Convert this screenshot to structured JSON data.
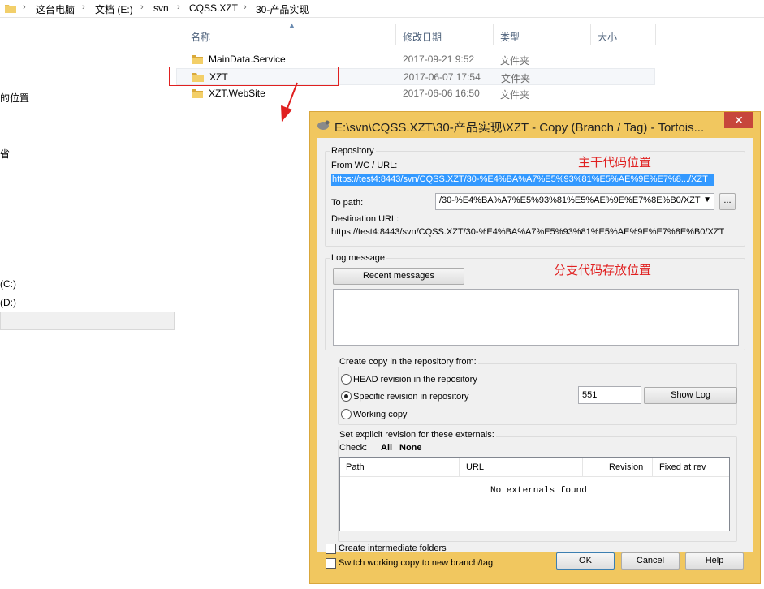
{
  "address_bar": {
    "crumbs": [
      "这台电脑",
      "文档 (E:)",
      "svn",
      "CQSS.XZT",
      "30-产品实现"
    ]
  },
  "nav_pane": {
    "items": [
      "的位置",
      "省",
      "(C:)",
      "(D:)"
    ]
  },
  "file_list": {
    "columns": {
      "name": "名称",
      "date": "修改日期",
      "type": "类型",
      "size": "大小"
    },
    "rows": [
      {
        "name": "MainData.Service",
        "date": "2017-09-21 9:52",
        "type": "文件夹"
      },
      {
        "name": "XZT",
        "date": "2017-06-07 17:54",
        "type": "文件夹"
      },
      {
        "name": "XZT.WebSite",
        "date": "2017-06-06 16:50",
        "type": "文件夹"
      }
    ]
  },
  "annotations": {
    "trunk_label": "主干代码位置",
    "branch_label": "分支代码存放位置",
    "color": "#e02020"
  },
  "dialog": {
    "title": "E:\\svn\\CQSS.XZT\\30-产品实现\\XZT - Copy (Branch / Tag) - Tortois...",
    "close_glyph": "✕",
    "repository": {
      "group_label": "Repository",
      "from_label": "From WC / URL:",
      "from_url": "https://test4:8443/svn/CQSS.XZT/30-%E4%BA%A7%E5%93%81%E5%AE%9E%E7%8.../XZT",
      "to_label": "To path:",
      "to_value": "/30-%E4%BA%A7%E5%93%81%E5%AE%9E%E7%8E%B0/XZT",
      "browse_label": "...",
      "dest_label": "Destination URL:",
      "dest_url": "https://test4:8443/svn/CQSS.XZT/30-%E4%BA%A7%E5%93%81%E5%AE%9E%E7%8E%B0/XZT"
    },
    "log": {
      "group_label": "Log message",
      "recent_button": "Recent messages"
    },
    "copy_from": {
      "group_label": "Create copy in the repository from:",
      "options": [
        "HEAD revision in the repository",
        "Specific revision in repository",
        "Working copy"
      ],
      "selected_index": 1,
      "revision": "551",
      "show_log_button": "Show Log"
    },
    "externals": {
      "group_label": "Set explicit revision for these externals:",
      "check_label": "Check:",
      "all_label": "All",
      "none_label": "None",
      "columns": [
        "Path",
        "URL",
        "Revision",
        "Fixed at rev"
      ],
      "empty_text": "No externals found"
    },
    "footer": {
      "create_intermediate": "Create intermediate folders",
      "switch_wc": "Switch working copy to new branch/tag",
      "ok": "OK",
      "cancel": "Cancel",
      "help": "Help"
    }
  }
}
